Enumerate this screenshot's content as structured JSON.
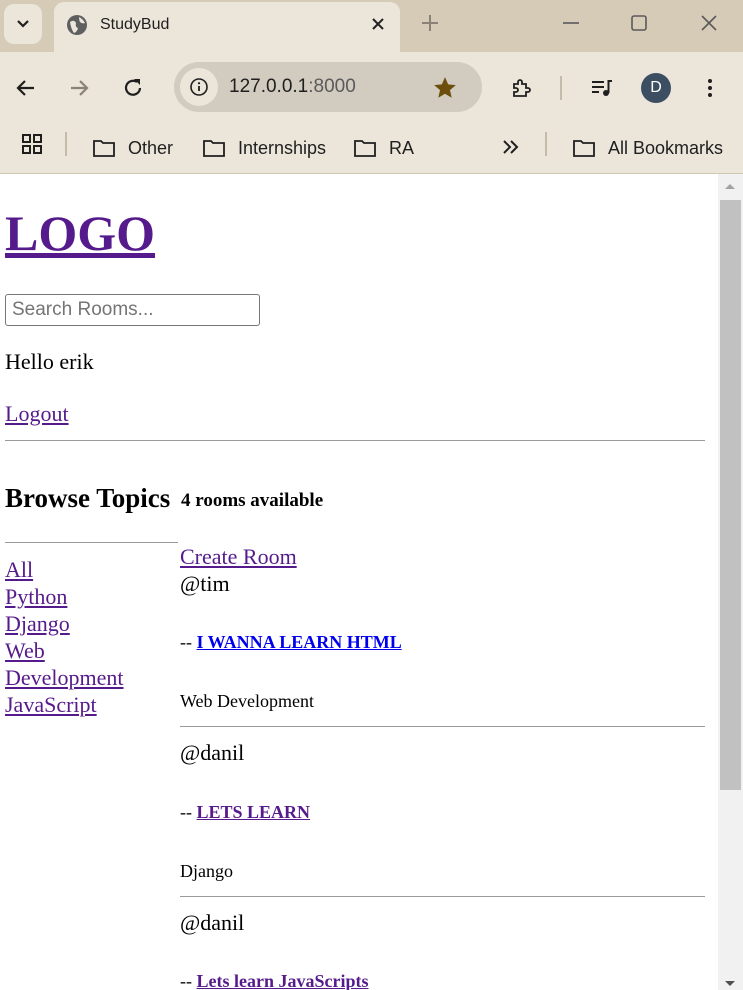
{
  "browser": {
    "tab_title": "StudyBud",
    "url_host": "127.0.0.1",
    "url_port": ":8000",
    "profile_initial": "D",
    "bookmarks": [
      "Other",
      "Internships",
      "RA"
    ],
    "all_bookmarks": "All Bookmarks",
    "icons": [
      "tab-list-icon",
      "globe-icon",
      "close-icon",
      "new-tab-icon",
      "minimize-icon",
      "maximize-icon",
      "window-close-icon",
      "back-icon",
      "forward-icon",
      "reload-icon",
      "site-info-icon",
      "star-icon",
      "extensions-icon",
      "media-icon",
      "more-icon",
      "apps-icon",
      "folder-icon",
      "chevron-double-right-icon"
    ],
    "colors": {
      "tabstrip": "#d6cbb7",
      "toolbar": "#ebe5da",
      "star": "#6b4f0b",
      "avatar": "#3c4f62"
    }
  },
  "page": {
    "logo": "LOGO",
    "search_placeholder": "Search Rooms...",
    "greeting": "Hello erik",
    "logout": "Logout",
    "browse_title": "Browse Topics",
    "rooms_count": "4 rooms available",
    "create_room": "Create Room",
    "topics": [
      "All",
      "Python",
      "Django",
      "Web",
      "Development",
      "JavaScript"
    ],
    "rooms": [
      {
        "host": "@tim",
        "prefix": "-- ",
        "name": "I WANNA LEARN HTML",
        "topic": "Web Development"
      },
      {
        "host": "@danil",
        "prefix": "-- ",
        "name": "LETS LEARN",
        "topic": "Django"
      },
      {
        "host": "@danil",
        "prefix": "-- ",
        "name": "Lets learn JavaScripts",
        "topic": ""
      }
    ],
    "colors": {
      "link_visited": "#551a8b",
      "link_unvisited": "#0000ee"
    }
  }
}
